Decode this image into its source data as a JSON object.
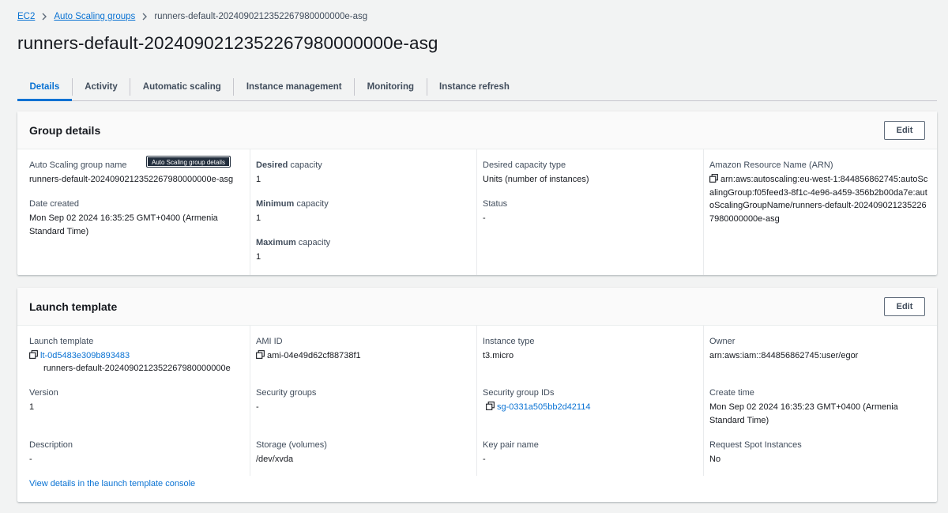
{
  "breadcrumb": {
    "items": [
      {
        "label": "EC2"
      },
      {
        "label": "Auto Scaling groups"
      }
    ],
    "current": "runners-default-2024090212352267980000000e-asg"
  },
  "page_title": "runners-default-2024090212352267980000000e-asg",
  "tabs": [
    {
      "label": "Details",
      "active": true
    },
    {
      "label": "Activity"
    },
    {
      "label": "Automatic scaling"
    },
    {
      "label": "Instance management"
    },
    {
      "label": "Monitoring"
    },
    {
      "label": "Instance refresh"
    }
  ],
  "group_details": {
    "title": "Group details",
    "edit_label": "Edit",
    "tooltip": "Auto Scaling group details",
    "name_label": "Auto Scaling group name",
    "name_value": "runners-default-2024090212352267980000000e-asg",
    "date_created_label": "Date created",
    "date_created_value": "Mon Sep 02 2024 16:35:25 GMT+0400 (Armenia Standard Time)",
    "desired_label_bold": "Desired",
    "desired_label_rest": " capacity",
    "desired_value": "1",
    "minimum_label_bold": "Minimum",
    "minimum_label_rest": " capacity",
    "minimum_value": "1",
    "maximum_label_bold": "Maximum",
    "maximum_label_rest": " capacity",
    "maximum_value": "1",
    "capacity_type_label": "Desired capacity type",
    "capacity_type_value": "Units (number of instances)",
    "status_label": "Status",
    "status_value": "-",
    "arn_label": "Amazon Resource Name (ARN)",
    "arn_value": "arn:aws:autoscaling:eu-west-1:844856862745:autoScalingGroup:f05feed3-8f1c-4e96-a459-356b2b00da7e:autoScalingGroupName/runners-default-2024090212352267980000000e-asg"
  },
  "launch_template": {
    "title": "Launch template",
    "edit_label": "Edit",
    "template_label": "Launch template",
    "template_id": "lt-0d5483e309b893483",
    "template_name": "runners-default-2024090212352267980000000e",
    "version_label": "Version",
    "version_value": "1",
    "description_label": "Description",
    "description_value": "-",
    "ami_label": "AMI ID",
    "ami_value": "ami-04e49d62cf88738f1",
    "security_groups_label": "Security groups",
    "security_groups_value": "-",
    "storage_label": "Storage (volumes)",
    "storage_value": "/dev/xvda",
    "instance_type_label": "Instance type",
    "instance_type_value": "t3.micro",
    "sg_ids_label": "Security group IDs",
    "sg_ids_value": "sg-0331a505bb2d42114",
    "key_pair_label": "Key pair name",
    "key_pair_value": "-",
    "owner_label": "Owner",
    "owner_value": "arn:aws:iam::844856862745:user/egor",
    "create_time_label": "Create time",
    "create_time_value": "Mon Sep 02 2024 16:35:23 GMT+0400 (Armenia Standard Time)",
    "spot_label": "Request Spot Instances",
    "spot_value": "No",
    "console_link": "View details in the launch template console"
  },
  "icons": {
    "copy": "copy-icon",
    "breadcrumb_separator": "chevron-right-icon"
  },
  "colors": {
    "link": "#0972d3",
    "background": "#f2f3f3",
    "text": "#16191f"
  }
}
